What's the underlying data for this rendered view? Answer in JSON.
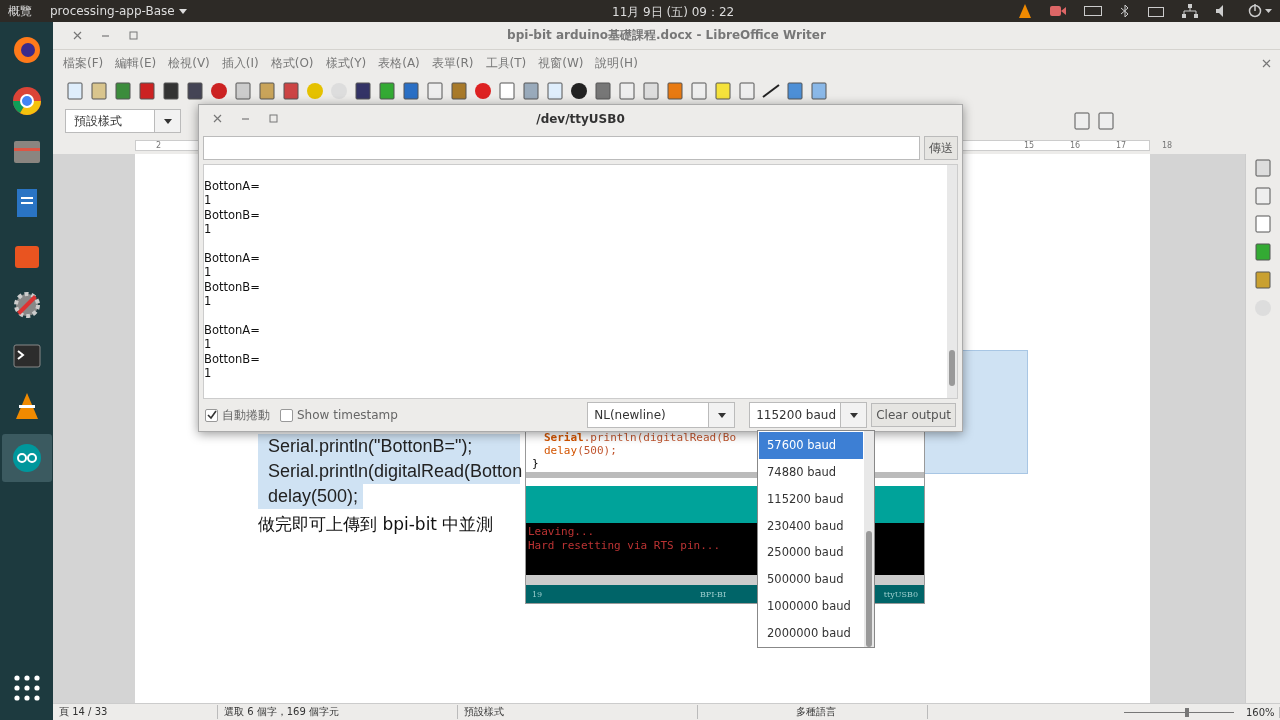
{
  "top_bar": {
    "activities": "概覽",
    "app_menu": "processing-app-Base",
    "clock": "11月 9日 (五) 09：22"
  },
  "dock": [
    {
      "kind": "firefox",
      "selected": false
    },
    {
      "kind": "chrome",
      "selected": false
    },
    {
      "kind": "files",
      "selected": false
    },
    {
      "kind": "writer",
      "selected": false
    },
    {
      "kind": "store",
      "selected": false
    },
    {
      "kind": "settings",
      "selected": false
    },
    {
      "kind": "terminal",
      "selected": false
    },
    {
      "kind": "vlc",
      "selected": false
    },
    {
      "kind": "arduino",
      "selected": true
    }
  ],
  "writer": {
    "title": "bpi-bit arduino基礎課程.docx - LibreOffice Writer",
    "menu": [
      "檔案(F)",
      "編輯(E)",
      "檢視(V)",
      "插入(I)",
      "格式(O)",
      "樣式(Y)",
      "表格(A)",
      "表單(R)",
      "工具(T)",
      "視窗(W)",
      "說明(H)"
    ],
    "paragraph_style": "預設樣式",
    "ruler": [
      "2",
      "15",
      "16",
      "17",
      "18"
    ],
    "code_lines": [
      "Serial.println(\"BottonB=\");",
      "Serial.println(digitalRead(Botton",
      "delay(500);"
    ],
    "paragraph": "做完即可上傳到 bpi-bit 中並測",
    "status_bar": [
      "頁 14 / 33",
      "選取 6 個字，169 個字元",
      "預設樣式",
      "多種語言"
    ],
    "zoom": {
      "reading": "160%",
      "level": 0.55
    }
  },
  "arduino": {
    "code": [
      {
        "obj": "Serial",
        "rest": ".println(digitalRead(Bo"
      },
      {
        "obj": "delay",
        "rest": "(500);"
      }
    ],
    "brace": "}",
    "console": [
      "Leaving...",
      "Hard resetting via RTS pin..."
    ],
    "footer": [
      "19",
      "BPI-BI",
      "ttyUSB0"
    ]
  },
  "serial_monitor": {
    "title": "/dev/ttyUSB0",
    "send": "傳送",
    "output": [
      [
        "BottonA=",
        "1",
        "BottonB=",
        "1"
      ],
      [
        "BottonA=",
        "1",
        "BottonB=",
        "1"
      ],
      [
        "BottonA=",
        "1",
        "BottonB=",
        "1"
      ]
    ],
    "autoscroll": {
      "label": "自動捲動",
      "checked": true
    },
    "timestamp": {
      "label": "Show timestamp",
      "checked": false
    },
    "line_ending": "NL(newline)",
    "baud": "115200 baud",
    "clear": "Clear output",
    "baud_options": [
      {
        "label": "57600 baud",
        "selected": true
      },
      {
        "label": "74880 baud",
        "selected": false
      },
      {
        "label": "115200 baud",
        "selected": false
      },
      {
        "label": "230400 baud",
        "selected": false
      },
      {
        "label": "250000 baud",
        "selected": false
      },
      {
        "label": "500000 baud",
        "selected": false
      },
      {
        "label": "1000000 baud",
        "selected": false
      },
      {
        "label": "2000000 baud",
        "selected": false
      }
    ]
  }
}
